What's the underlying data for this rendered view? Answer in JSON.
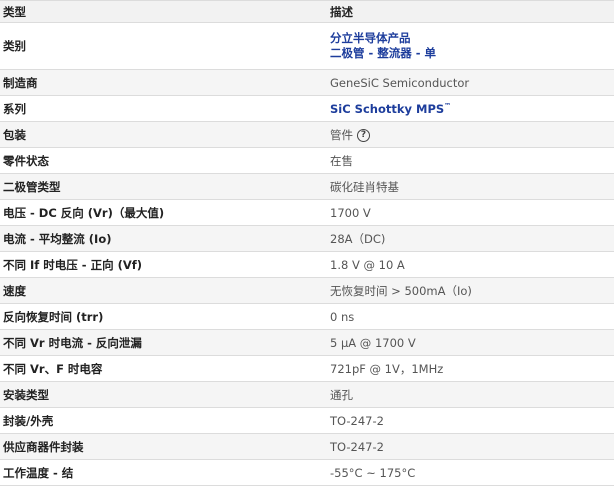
{
  "header": {
    "col_type": "类型",
    "col_desc": "描述"
  },
  "rows": {
    "category": {
      "label": "类别",
      "link1": "分立半导体产品",
      "link2": "二极管 - 整流器 - 单"
    },
    "manufacturer": {
      "label": "制造商",
      "value": "GeneSiC Semiconductor"
    },
    "series": {
      "label": "系列",
      "value": "SiC Schottky MPS",
      "tm": "™"
    },
    "package": {
      "label": "包装",
      "value": "管件",
      "help_icon": "question-circle-icon"
    },
    "part_status": {
      "label": "零件状态",
      "value": "在售"
    },
    "diode_type": {
      "label": "二极管类型",
      "value": "碳化硅肖特基"
    },
    "voltage_dc_reverse": {
      "label": "电压 - DC 反向 (Vr)（最大值)",
      "value": "1700 V"
    },
    "current_avg_rectified": {
      "label": "电流 - 平均整流 (Io)",
      "value": "28A（DC)"
    },
    "voltage_forward": {
      "label": "不同 If 时电压 - 正向 (Vf)",
      "value": "1.8 V @ 10 A"
    },
    "speed": {
      "label": "速度",
      "value": "无恢复时间 > 500mA（Io)"
    },
    "reverse_recovery_time": {
      "label": "反向恢复时间 (trr)",
      "value": "0 ns"
    },
    "reverse_leakage": {
      "label": "不同 Vr 时电流 - 反向泄漏",
      "value": "5 µA @ 1700 V"
    },
    "capacitance": {
      "label": "不同 Vr、F 时电容",
      "value": "721pF @ 1V，1MHz"
    },
    "mounting_type": {
      "label": "安装类型",
      "value": "通孔"
    },
    "package_case": {
      "label": "封装/外壳",
      "value": "TO-247-2"
    },
    "supplier_device_package": {
      "label": "供应商器件封装",
      "value": "TO-247-2"
    },
    "operating_temp": {
      "label": "工作温度 - 结",
      "value": "-55°C ~ 175°C"
    }
  }
}
